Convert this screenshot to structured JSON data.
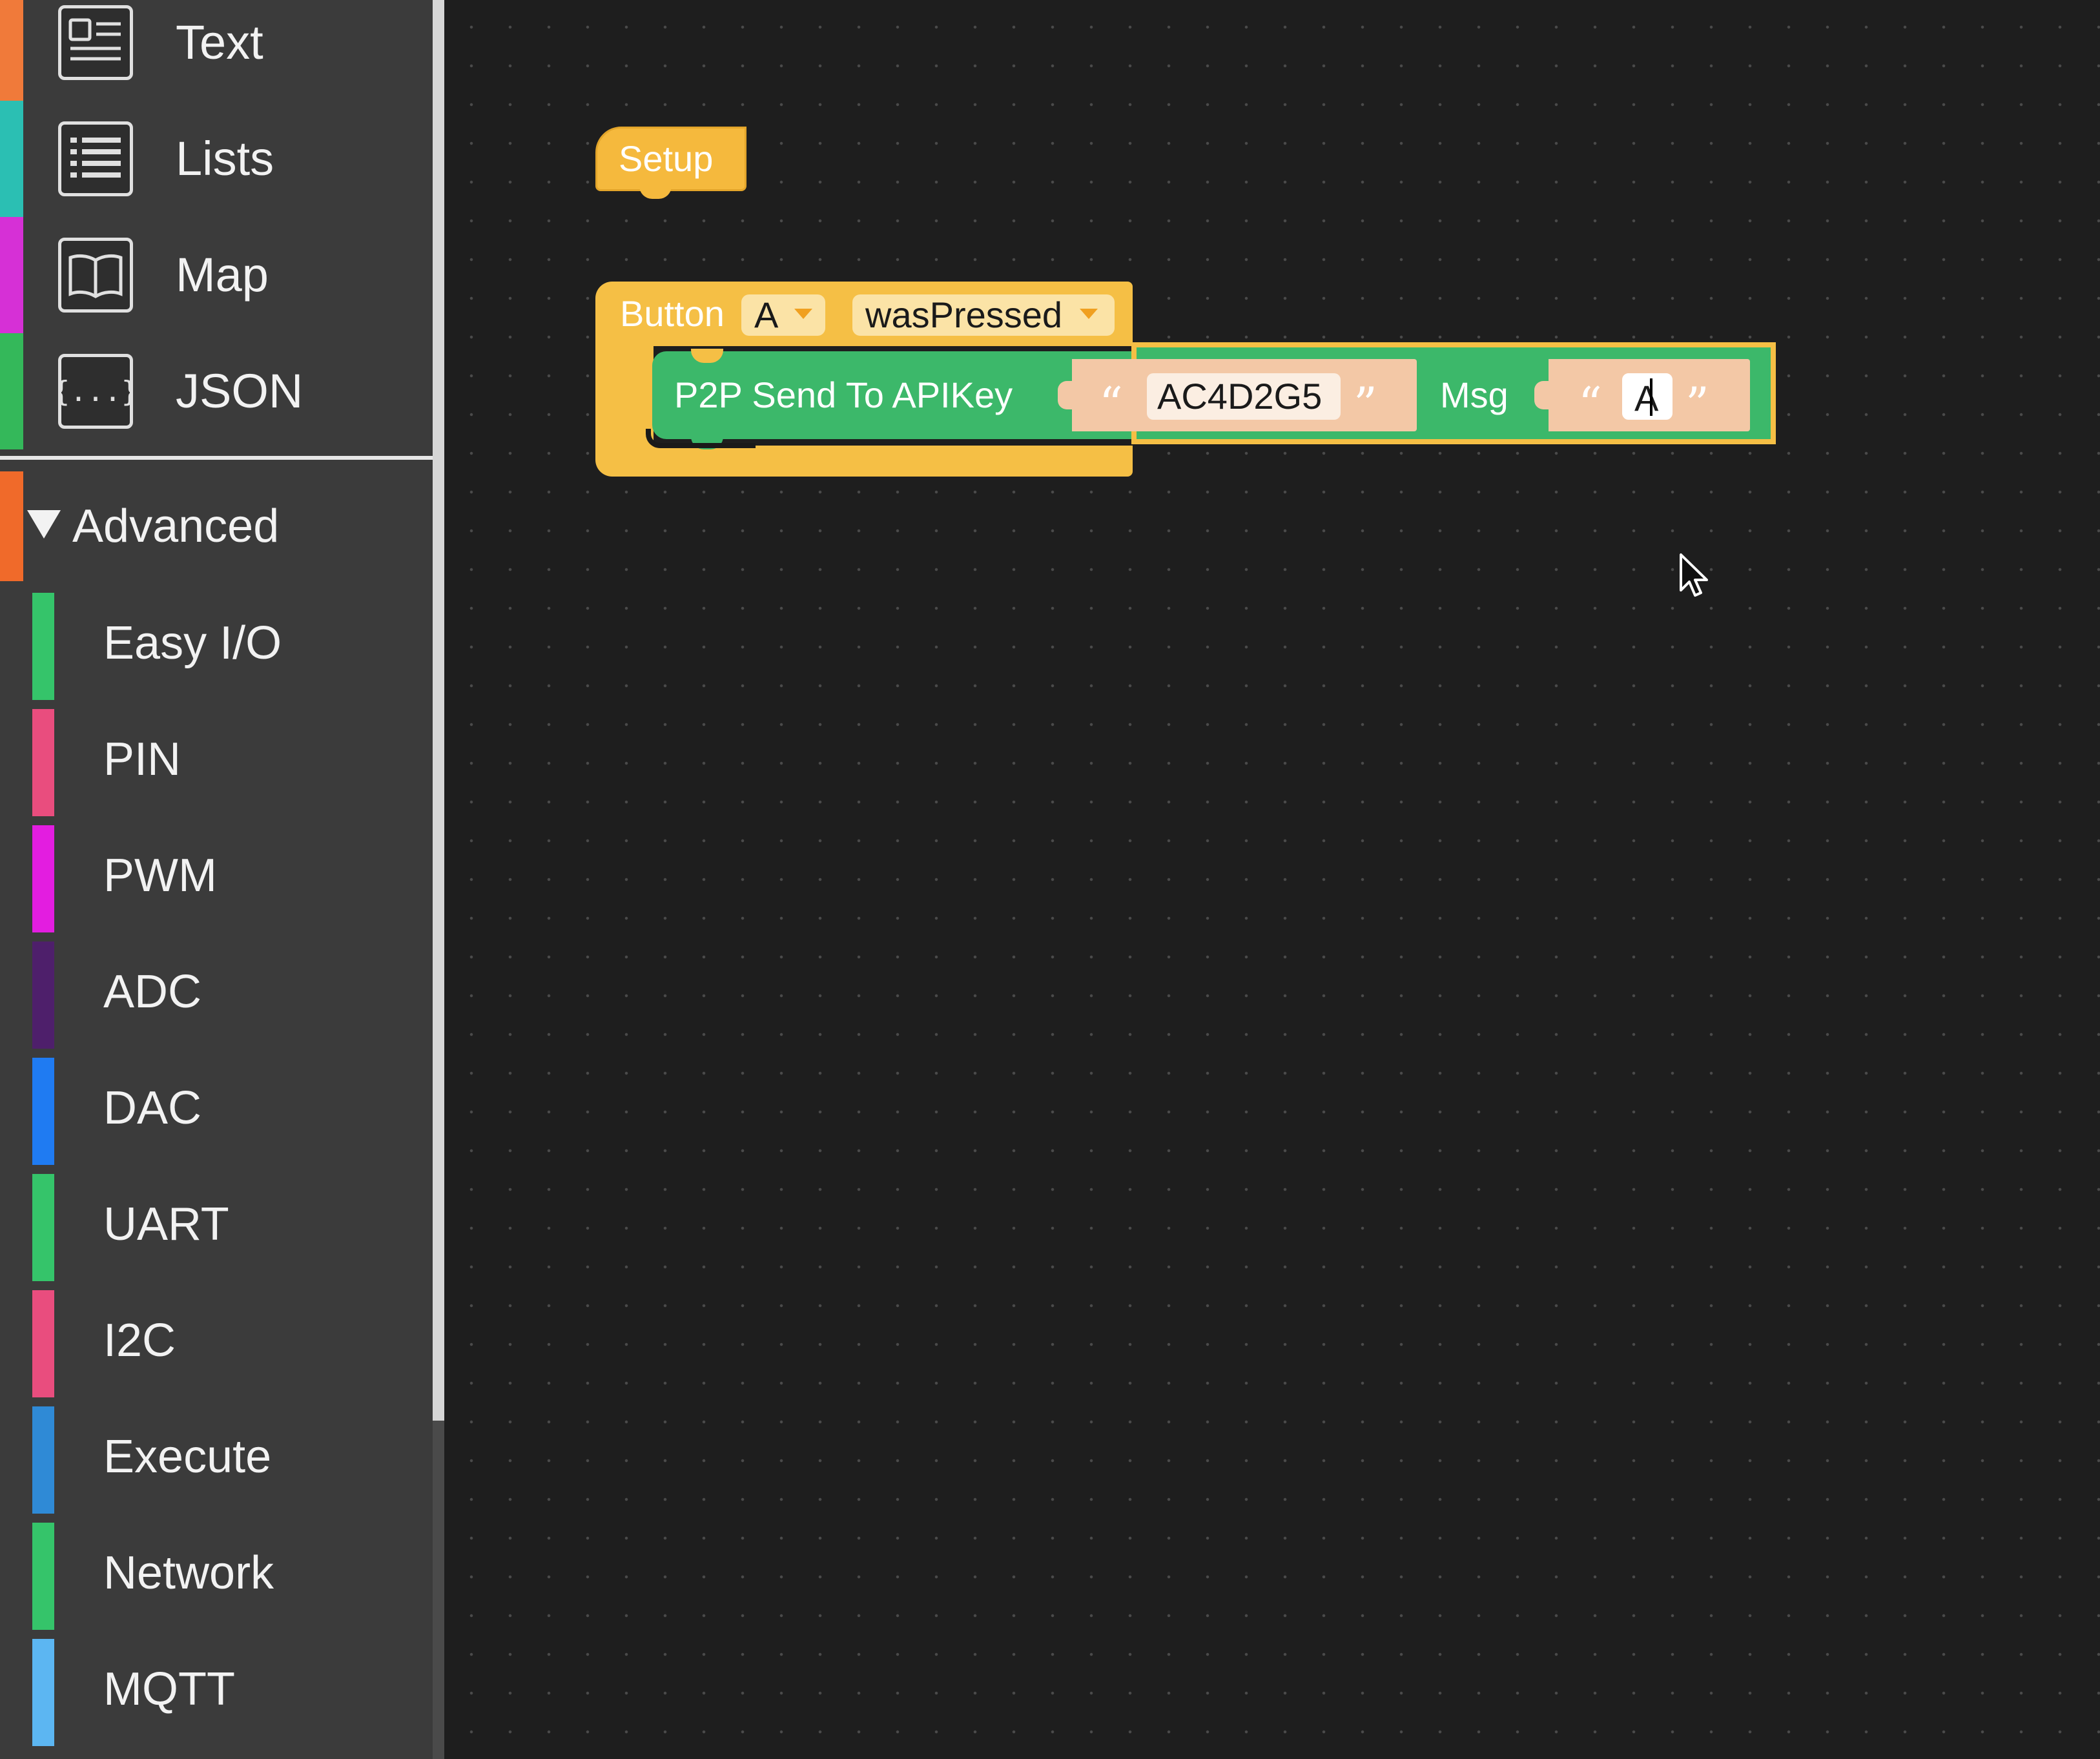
{
  "toolbox": {
    "top_categories": [
      {
        "label": "Text",
        "color": "#f07a3a",
        "icon": "text-icon"
      },
      {
        "label": "Lists",
        "color": "#2bbfb3",
        "icon": "list-icon"
      },
      {
        "label": "Map",
        "color": "#d630d6",
        "icon": "book-icon"
      },
      {
        "label": "JSON",
        "color": "#34b85a",
        "icon": "braces-icon"
      }
    ],
    "advanced": {
      "label": "Advanced",
      "expanded": true
    },
    "advanced_categories": [
      {
        "label": "Easy I/O",
        "color": "#35c46a"
      },
      {
        "label": "PIN",
        "color": "#e94d7e"
      },
      {
        "label": "PWM",
        "color": "#e31de0"
      },
      {
        "label": "ADC",
        "color": "#4e1f6b"
      },
      {
        "label": "DAC",
        "color": "#1f7bf2"
      },
      {
        "label": "UART",
        "color": "#35c46a"
      },
      {
        "label": "I2C",
        "color": "#e94d7e"
      },
      {
        "label": "Execute",
        "color": "#2f8ad6"
      },
      {
        "label": "Network",
        "color": "#35c46a"
      },
      {
        "label": "MQTT",
        "color": "#5cb6f2"
      }
    ]
  },
  "workspace": {
    "setup_block": {
      "label": "Setup"
    },
    "event_block": {
      "label": "Button",
      "button": "A",
      "event": "wasPressed"
    },
    "p2p_block": {
      "label": "P2P Send To APIKey",
      "apikey_open_quote": "“",
      "apikey": "AC4D2G5",
      "apikey_close_quote": "”",
      "msg_label": "Msg",
      "msg_open_quote": "“",
      "msg": "A",
      "msg_close_quote": "”"
    }
  }
}
